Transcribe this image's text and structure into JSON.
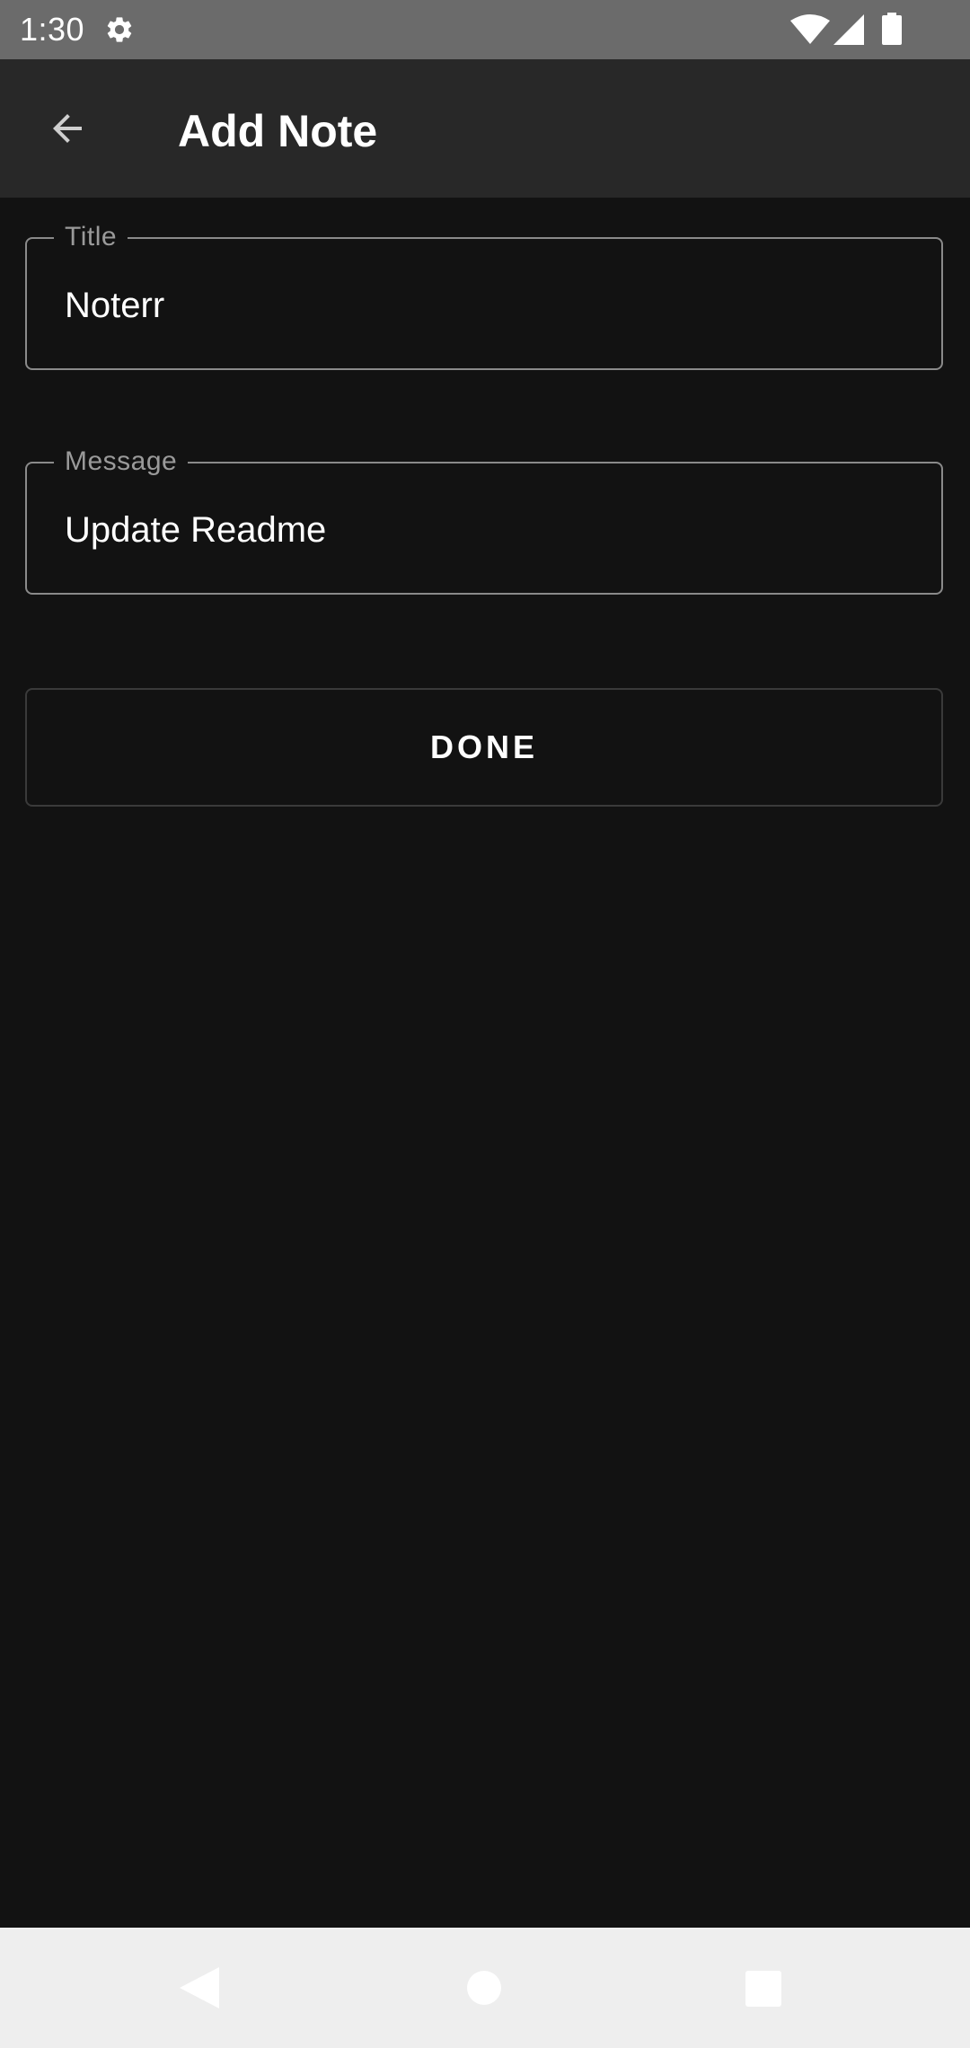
{
  "status_bar": {
    "time": "1:30",
    "icons": [
      "gear-icon",
      "wifi-icon",
      "signal-icon",
      "battery-icon"
    ]
  },
  "app_bar": {
    "title": "Add Note",
    "back_icon": "arrow-left-icon"
  },
  "form": {
    "title_field": {
      "label": "Title",
      "value": "Noterr"
    },
    "message_field": {
      "label": "Message",
      "value": "Update Readme"
    },
    "done_label": "DONE"
  },
  "nav_bar": {
    "icons": [
      "back-triangle-icon",
      "home-circle-icon",
      "recents-square-icon"
    ]
  },
  "colors": {
    "background": "#121212",
    "app_bar": "#282828",
    "status_bar": "#6b6b6b",
    "field_border": "#8a8a8a",
    "label": "#9a9a9a",
    "nav_bar": "#eeeeee"
  }
}
